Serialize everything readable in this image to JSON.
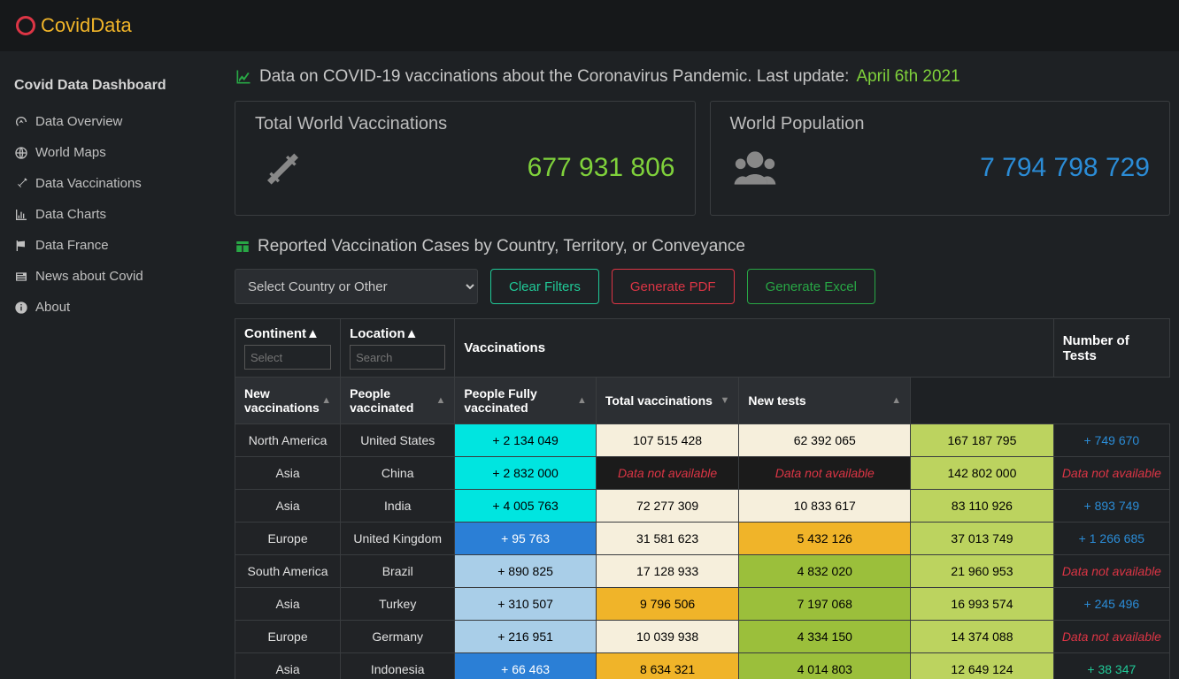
{
  "brand": "CovidData",
  "sidebar": {
    "header": "Covid Data Dashboard",
    "items": [
      {
        "label": "Data Overview"
      },
      {
        "label": "World Maps"
      },
      {
        "label": "Data Vaccinations"
      },
      {
        "label": "Data Charts"
      },
      {
        "label": "Data France"
      },
      {
        "label": "News about Covid"
      },
      {
        "label": "About"
      }
    ]
  },
  "header": {
    "text": "Data on COVID-19 vaccinations about the Coronavirus Pandemic. Last update: ",
    "date": "April 6th 2021"
  },
  "cards": {
    "vaccinations": {
      "title": "Total World Vaccinations",
      "value": "677 931 806"
    },
    "population": {
      "title": "World Population",
      "value": "7 794 798 729"
    }
  },
  "section_title": "Reported Vaccination Cases by Country, Territory, or Conveyance",
  "controls": {
    "select_placeholder": "Select Country or Other",
    "clear": "Clear Filters",
    "pdf": "Generate PDF",
    "excel": "Generate Excel"
  },
  "table": {
    "groups": {
      "continent": "Continent",
      "location": "Location",
      "vaccinations": "Vaccinations",
      "tests": "Number of Tests"
    },
    "cols": {
      "new_vacc": "New vaccinations",
      "people_vacc": "People vaccinated",
      "fully_vacc": "People Fully vaccinated",
      "total_vacc": "Total vaccinations",
      "new_tests": "New tests"
    },
    "filters": {
      "continent": "Select",
      "location": "Search"
    },
    "na": "Data not available",
    "rows": [
      {
        "continent": "North America",
        "location": "United States",
        "new": "+ 2 134 049",
        "nv": "cyan",
        "pv": "107 515 428",
        "pvc": "cream",
        "fv": "62 392 065",
        "fvc": "cream",
        "tv": "167 187 795",
        "tvc": "lime",
        "nt": "+ 749 670",
        "ntc": "blue"
      },
      {
        "continent": "Asia",
        "location": "China",
        "new": "+ 2 832 000",
        "nv": "cyan",
        "pv": "NA",
        "pvc": "dark",
        "fv": "NA",
        "fvc": "dark",
        "tv": "142 802 000",
        "tvc": "lime",
        "nt": "NA",
        "ntc": "red"
      },
      {
        "continent": "Asia",
        "location": "India",
        "new": "+ 4 005 763",
        "nv": "cyan",
        "pv": "72 277 309",
        "pvc": "cream",
        "fv": "10 833 617",
        "fvc": "cream",
        "tv": "83 110 926",
        "tvc": "lime",
        "nt": "+ 893 749",
        "ntc": "blue"
      },
      {
        "continent": "Europe",
        "location": "United Kingdom",
        "new": "+ 95 763",
        "nv": "blue",
        "pv": "31 581 623",
        "pvc": "cream",
        "fv": "5 432 126",
        "fvc": "orange",
        "tv": "37 013 749",
        "tvc": "lime",
        "nt": "+ 1 266 685",
        "ntc": "blue"
      },
      {
        "continent": "South America",
        "location": "Brazil",
        "new": "+ 890 825",
        "nv": "lblue",
        "pv": "17 128 933",
        "pvc": "cream",
        "fv": "4 832 020",
        "fvc": "green",
        "tv": "21 960 953",
        "tvc": "lime",
        "nt": "NA",
        "ntc": "red"
      },
      {
        "continent": "Asia",
        "location": "Turkey",
        "new": "+ 310 507",
        "nv": "lblue",
        "pv": "9 796 506",
        "pvc": "orange",
        "fv": "7 197 068",
        "fvc": "green",
        "tv": "16 993 574",
        "tvc": "lime",
        "nt": "+ 245 496",
        "ntc": "blue"
      },
      {
        "continent": "Europe",
        "location": "Germany",
        "new": "+ 216 951",
        "nv": "lblue",
        "pv": "10 039 938",
        "pvc": "cream",
        "fv": "4 334 150",
        "fvc": "green",
        "tv": "14 374 088",
        "tvc": "lime",
        "nt": "NA",
        "ntc": "red"
      },
      {
        "continent": "Asia",
        "location": "Indonesia",
        "new": "+ 66 463",
        "nv": "blue",
        "pv": "8 634 321",
        "pvc": "orange",
        "fv": "4 014 803",
        "fvc": "green",
        "tv": "12 649 124",
        "tvc": "lime",
        "nt": "+ 38 347",
        "ntc": "teal"
      }
    ]
  }
}
